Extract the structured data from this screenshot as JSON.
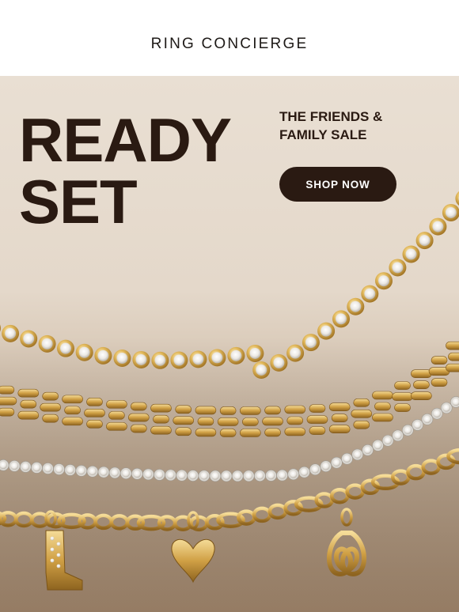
{
  "header": {
    "brand": "RING CONCIERGE"
  },
  "hero": {
    "headline_line1": "READY",
    "headline_line2": "SET",
    "sale_line1": "THE FRIENDS &",
    "sale_line2": "FAMILY SALE",
    "cta_label": "SHOP NOW"
  },
  "colors": {
    "background": "#e6dbce",
    "text_dark": "#2a1a12",
    "button_bg": "#2a1a12",
    "button_text": "#ffffff",
    "gold": "#d2a64a",
    "silver": "#e8e6e2"
  },
  "jewelry": [
    "tennis-bracelet-gold",
    "panther-link-chain",
    "tennis-bracelet-white",
    "charm-chain-with-boot-heart-pretzel"
  ]
}
